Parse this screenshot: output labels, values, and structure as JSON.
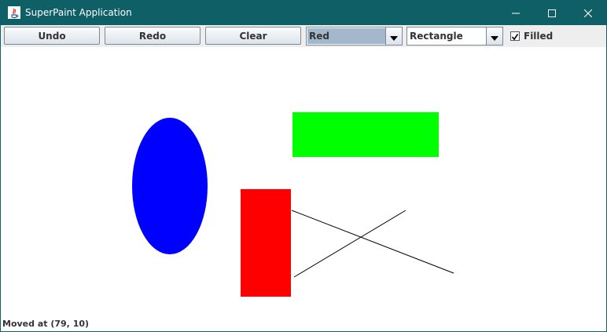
{
  "window": {
    "title": "SuperPaint Application",
    "titlebar_color": "#0f5f66"
  },
  "titlebar_controls": {
    "minimize_icon": "minimize-icon",
    "maximize_icon": "maximize-icon",
    "close_icon": "close-icon"
  },
  "toolbar": {
    "undo_label": "Undo",
    "redo_label": "Redo",
    "clear_label": "Clear",
    "color_select": {
      "value": "Red",
      "highlight_color": "#a3b8cc"
    },
    "shape_select": {
      "value": "Rectangle"
    },
    "filled": {
      "label": "Filled",
      "checked": true
    }
  },
  "drawing": {
    "shapes": [
      {
        "type": "oval",
        "filled": true,
        "color": "#0000ff"
      },
      {
        "type": "rectangle",
        "filled": true,
        "color": "#00ff00"
      },
      {
        "type": "rectangle",
        "filled": true,
        "color": "#ff0000"
      },
      {
        "type": "line",
        "color": "#000000"
      },
      {
        "type": "line",
        "color": "#000000"
      }
    ]
  },
  "status": {
    "text": "Moved at (79, 10)"
  }
}
